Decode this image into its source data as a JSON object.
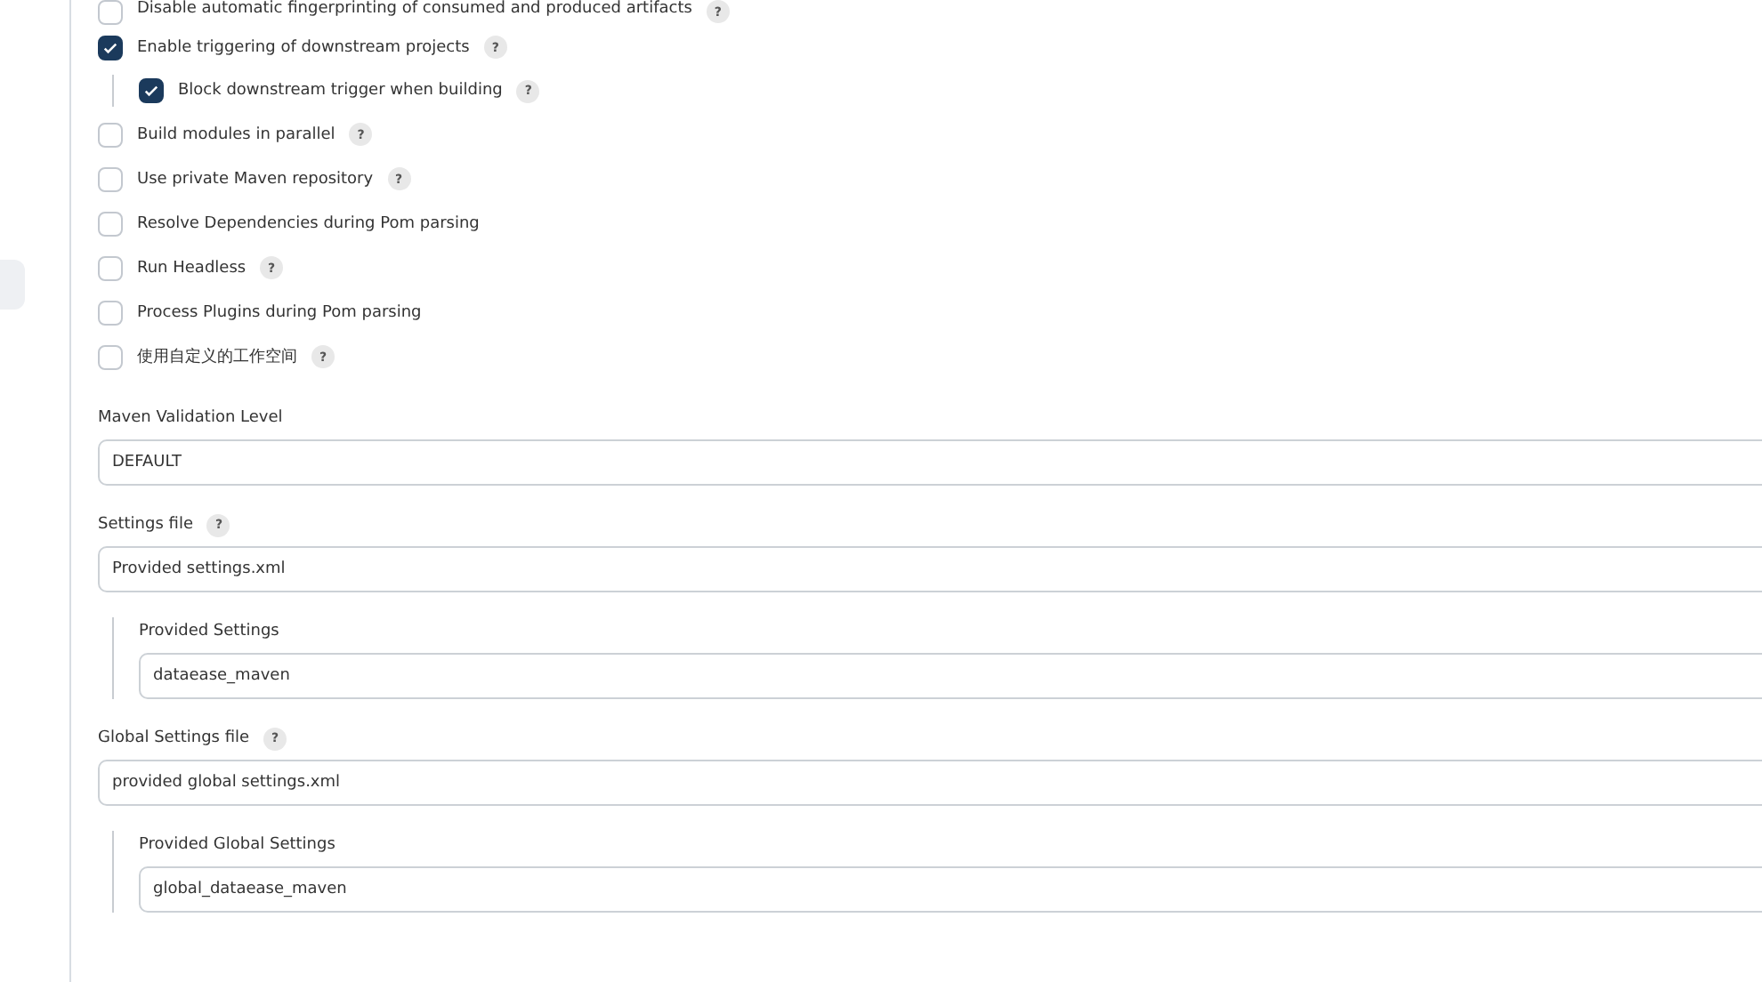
{
  "options": [
    {
      "label": "Disable automatic fingerprinting of consumed and produced artifacts",
      "checked": false,
      "help": "?"
    },
    {
      "label": "Enable triggering of downstream projects",
      "checked": true,
      "help": "?",
      "children": [
        {
          "label": "Block downstream trigger when building",
          "checked": true,
          "help": "?"
        }
      ]
    },
    {
      "label": "Build modules in parallel",
      "checked": false,
      "help": "?"
    },
    {
      "label": "Use private Maven repository",
      "checked": false,
      "help": "?"
    },
    {
      "label": "Resolve Dependencies during Pom parsing",
      "checked": false
    },
    {
      "label": "Run Headless",
      "checked": false,
      "help": "?"
    },
    {
      "label": "Process Plugins during Pom parsing",
      "checked": false
    },
    {
      "label": "使用自定义的工作空间",
      "checked": false,
      "help": "?"
    }
  ],
  "fields": [
    {
      "label": "Maven Validation Level",
      "value": "DEFAULT"
    },
    {
      "label": "Settings file",
      "help": "?",
      "value": "Provided settings.xml",
      "nested": {
        "label": "Provided Settings",
        "value": "dataease_maven"
      }
    },
    {
      "label": "Global Settings file",
      "help": "?",
      "value": "provided global settings.xml",
      "nested": {
        "label": "Provided Global Settings",
        "value": "global_dataease_maven"
      }
    }
  ]
}
